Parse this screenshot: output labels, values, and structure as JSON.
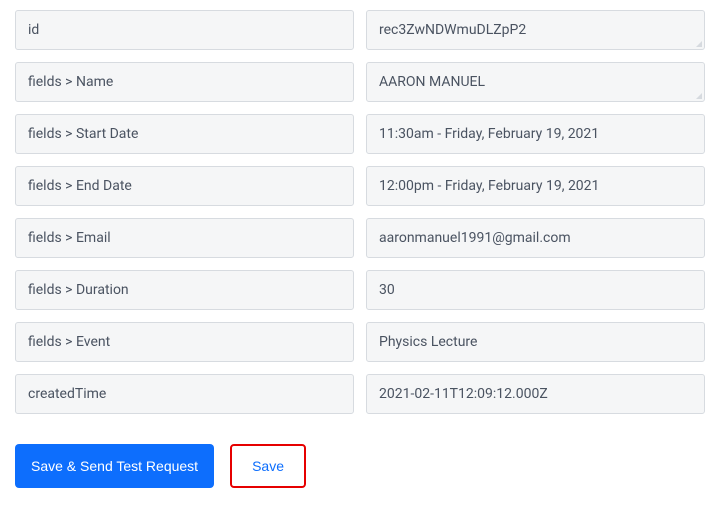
{
  "rows": [
    {
      "key": "id",
      "value": "rec3ZwNDWmuDLZpP2"
    },
    {
      "key": "fields > Name",
      "value": "AARON MANUEL"
    },
    {
      "key": "fields > Start Date",
      "value": "11:30am - Friday, February 19, 2021"
    },
    {
      "key": "fields > End Date",
      "value": "12:00pm - Friday, February 19, 2021"
    },
    {
      "key": "fields > Email",
      "value": "aaronmanuel1991@gmail.com"
    },
    {
      "key": "fields > Duration",
      "value": "30"
    },
    {
      "key": "fields > Event",
      "value": "Physics Lecture"
    },
    {
      "key": "createdTime",
      "value": "2021-02-11T12:09:12.000Z"
    }
  ],
  "buttons": {
    "save_send": "Save & Send Test Request",
    "save": "Save"
  }
}
